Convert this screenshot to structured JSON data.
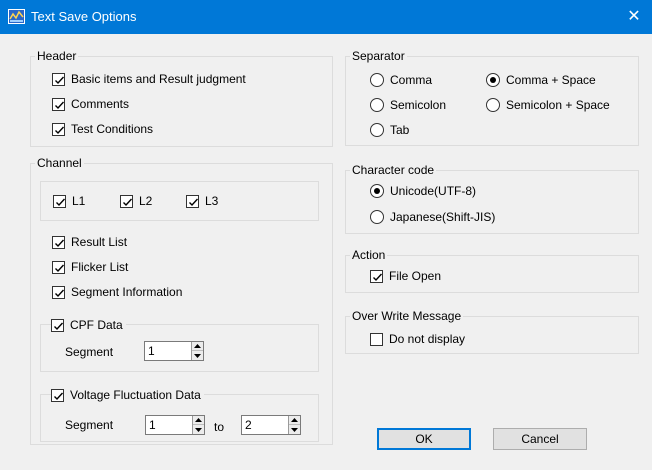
{
  "window": {
    "title": "Text Save Options",
    "close_symbol": "✕"
  },
  "header_group": {
    "title": "Header",
    "items": [
      {
        "label": "Basic items and Result judgment",
        "checked": true
      },
      {
        "label": "Comments",
        "checked": true
      },
      {
        "label": "Test Conditions",
        "checked": true
      }
    ]
  },
  "channel_group": {
    "title": "Channel",
    "channels": [
      {
        "label": "L1",
        "checked": true
      },
      {
        "label": "L2",
        "checked": true
      },
      {
        "label": "L3",
        "checked": true
      }
    ],
    "lists": [
      {
        "label": "Result List",
        "checked": true
      },
      {
        "label": "Flicker List",
        "checked": true
      },
      {
        "label": "Segment Information",
        "checked": true
      }
    ],
    "cpf": {
      "label": "CPF Data",
      "checked": true,
      "segment_label": "Segment",
      "segment_value": "1"
    },
    "voltage": {
      "label": "Voltage Fluctuation Data",
      "checked": true,
      "segment_label": "Segment",
      "from_value": "1",
      "to_label": "to",
      "to_value": "2"
    }
  },
  "separator_group": {
    "title": "Separator",
    "options": [
      {
        "label": "Comma",
        "selected": false
      },
      {
        "label": "Comma + Space",
        "selected": true
      },
      {
        "label": "Semicolon",
        "selected": false
      },
      {
        "label": "Semicolon + Space",
        "selected": false
      },
      {
        "label": "Tab",
        "selected": false
      }
    ]
  },
  "charcode_group": {
    "title": "Character code",
    "options": [
      {
        "label": "Unicode(UTF-8)",
        "selected": true
      },
      {
        "label": "Japanese(Shift-JIS)",
        "selected": false
      }
    ]
  },
  "action_group": {
    "title": "Action",
    "file_open": {
      "label": "File Open",
      "checked": true
    }
  },
  "overwrite_group": {
    "title": "Over Write Message",
    "do_not_display": {
      "label": "Do not display",
      "checked": false
    }
  },
  "buttons": {
    "ok": "OK",
    "cancel": "Cancel"
  },
  "colors": {
    "titlebar": "#0078d7",
    "background": "#f0f0f0",
    "default_button_border": "#0078d7"
  }
}
